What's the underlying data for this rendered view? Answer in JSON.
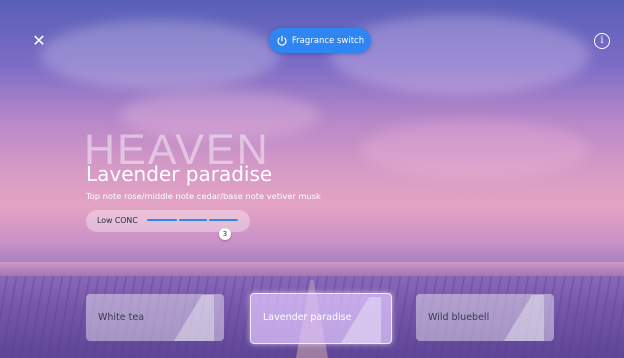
{
  "topbar": {
    "close_icon": "close-icon",
    "switch_label": "Fragrance switch",
    "switch_icon": "power-icon",
    "info_icon": "info-icon",
    "accent_color": "#2f86f2"
  },
  "fragrance": {
    "watermark": "HEAVEN",
    "name": "Lavender paradise",
    "notes": "Top note rose/middle note cedar/base note vetiver musk"
  },
  "concentration": {
    "label": "Low CONC",
    "level": "3",
    "segments": 3
  },
  "cards": [
    {
      "label": "White tea",
      "selected": false
    },
    {
      "label": "Lavender paradise",
      "selected": true
    },
    {
      "label": "Wild bluebell",
      "selected": false
    }
  ]
}
